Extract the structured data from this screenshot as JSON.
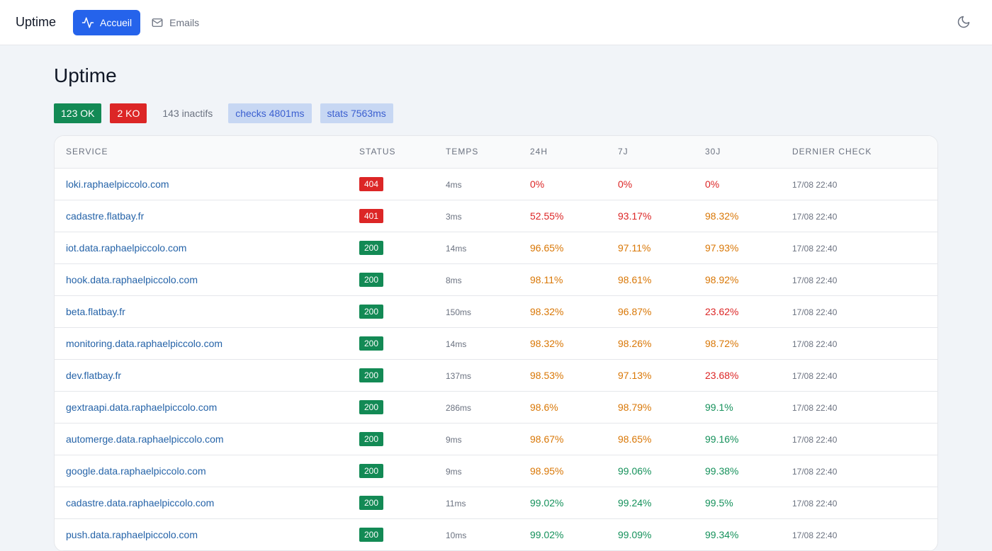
{
  "header": {
    "brand": "Uptime",
    "nav": [
      {
        "label": "Accueil",
        "icon": "activity-icon",
        "active": true
      },
      {
        "label": "Emails",
        "icon": "mail-icon",
        "active": false
      }
    ],
    "theme_icon": "moon-icon"
  },
  "page": {
    "title": "Uptime",
    "stats": {
      "ok": "123 OK",
      "ko": "2 KO",
      "inactive": "143 inactifs",
      "checks": "checks 4801ms",
      "stats": "stats 7563ms"
    }
  },
  "table": {
    "headers": [
      "Service",
      "Status",
      "Temps",
      "24h",
      "7j",
      "30j",
      "Dernier check"
    ],
    "rows": [
      {
        "service": "loki.raphaelpiccolo.com",
        "status": "404",
        "time": "4ms",
        "d1": "0%",
        "d7": "0%",
        "d30": "0%",
        "last": "17/08 22:40"
      },
      {
        "service": "cadastre.flatbay.fr",
        "status": "401",
        "time": "3ms",
        "d1": "52.55%",
        "d7": "93.17%",
        "d30": "98.32%",
        "last": "17/08 22:40"
      },
      {
        "service": "iot.data.raphaelpiccolo.com",
        "status": "200",
        "time": "14ms",
        "d1": "96.65%",
        "d7": "97.11%",
        "d30": "97.93%",
        "last": "17/08 22:40"
      },
      {
        "service": "hook.data.raphaelpiccolo.com",
        "status": "200",
        "time": "8ms",
        "d1": "98.11%",
        "d7": "98.61%",
        "d30": "98.92%",
        "last": "17/08 22:40"
      },
      {
        "service": "beta.flatbay.fr",
        "status": "200",
        "time": "150ms",
        "d1": "98.32%",
        "d7": "96.87%",
        "d30": "23.62%",
        "last": "17/08 22:40"
      },
      {
        "service": "monitoring.data.raphaelpiccolo.com",
        "status": "200",
        "time": "14ms",
        "d1": "98.32%",
        "d7": "98.26%",
        "d30": "98.72%",
        "last": "17/08 22:40"
      },
      {
        "service": "dev.flatbay.fr",
        "status": "200",
        "time": "137ms",
        "d1": "98.53%",
        "d7": "97.13%",
        "d30": "23.68%",
        "last": "17/08 22:40"
      },
      {
        "service": "gextraapi.data.raphaelpiccolo.com",
        "status": "200",
        "time": "286ms",
        "d1": "98.6%",
        "d7": "98.79%",
        "d30": "99.1%",
        "last": "17/08 22:40"
      },
      {
        "service": "automerge.data.raphaelpiccolo.com",
        "status": "200",
        "time": "9ms",
        "d1": "98.67%",
        "d7": "98.65%",
        "d30": "99.16%",
        "last": "17/08 22:40"
      },
      {
        "service": "google.data.raphaelpiccolo.com",
        "status": "200",
        "time": "9ms",
        "d1": "98.95%",
        "d7": "99.06%",
        "d30": "99.38%",
        "last": "17/08 22:40"
      },
      {
        "service": "cadastre.data.raphaelpiccolo.com",
        "status": "200",
        "time": "11ms",
        "d1": "99.02%",
        "d7": "99.24%",
        "d30": "99.5%",
        "last": "17/08 22:40"
      },
      {
        "service": "push.data.raphaelpiccolo.com",
        "status": "200",
        "time": "10ms",
        "d1": "99.02%",
        "d7": "99.09%",
        "d30": "99.34%",
        "last": "17/08 22:40"
      }
    ]
  }
}
